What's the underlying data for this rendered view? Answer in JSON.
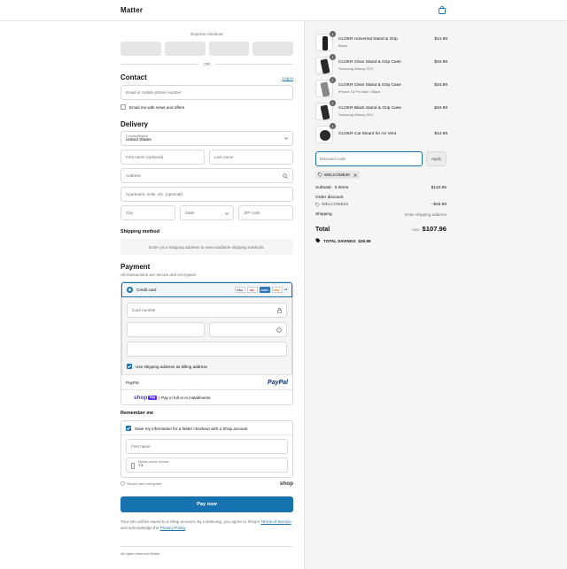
{
  "header": {
    "logo": "Matter",
    "cart_icon": "shopping-bag-icon"
  },
  "express": {
    "title": "Express checkout",
    "or": "OR"
  },
  "contact": {
    "heading": "Contact",
    "login": "Log in",
    "email_placeholder": "Email or mobile phone number",
    "news_label": "Email me with news and offers"
  },
  "delivery": {
    "heading": "Delivery",
    "country_label": "Country/Region",
    "country_value": "United States",
    "first_name": "First name (optional)",
    "last_name": "Last name",
    "address": "Address",
    "apartment": "Apartment, suite, etc. (optional)",
    "city": "City",
    "state": "State",
    "zip": "ZIP code"
  },
  "shipping": {
    "heading": "Shipping method",
    "message": "Enter your shipping address to view available shipping methods."
  },
  "payment": {
    "heading": "Payment",
    "subtitle": "All transactions are secure and encrypted.",
    "credit_card": "Credit card",
    "card_logos": [
      "VISA",
      "MC",
      "AMEX",
      "DISC",
      "+4"
    ],
    "card_number": "Card number",
    "billing_label": "Use shipping address as billing address",
    "paypal": "PayPal",
    "paypal_logo": "PayPal",
    "shoppay_logo": "shop",
    "shoppay_badge": "Pay",
    "shoppay_text": "Pay in full or in installments"
  },
  "remember": {
    "heading": "Remember me",
    "save_label": "Save my information for a faster checkout with a Shop account",
    "first_name": "First name",
    "phone_label": "Mobile phone number",
    "phone_prefix": "+1",
    "secure": "Secure and encrypted",
    "shop_logo": "shop"
  },
  "paynow": {
    "label": "Pay now"
  },
  "legal": {
    "text1": "Your info will be saved to a Shop account. By continuing, you agree to Shop's",
    "terms": "Terms of Service",
    "text2": "and acknowledge the",
    "privacy": "Privacy Policy",
    "dot": "."
  },
  "footer": {
    "rights": "All rights reserved Matter"
  },
  "cart": {
    "items": [
      {
        "qty": "1",
        "name": "CLOKR Universal Stand & Grip",
        "variant": "Black",
        "price": "$14.99"
      },
      {
        "qty": "1",
        "name": "CLOKR Clear Stand & Grip Case",
        "variant": "Samsung Galaxy S23",
        "price": "$34.99"
      },
      {
        "qty": "1",
        "name": "CLOKR Clear Stand & Grip Case",
        "variant": "iPhone 15 Pro Max / Black",
        "price": "$34.99"
      },
      {
        "qty": "1",
        "name": "CLOKR Black Stand & Grip Case",
        "variant": "Samsung Galaxy S23",
        "price": "$34.99"
      },
      {
        "qty": "1",
        "name": "CLOKR Car Mount for Air Vent",
        "variant": "",
        "price": "$14.99"
      }
    ],
    "discount_placeholder": "Discount code",
    "apply": "Apply",
    "tag": "WELCOME20",
    "subtotal_label": "Subtotal · 5 items",
    "subtotal": "$134.95",
    "order_discount": "Order discount",
    "discount_code": "WELCOME20",
    "discount_value": "−$26.99",
    "shipping_label": "Shipping",
    "shipping_value": "Enter shipping address",
    "total_label": "Total",
    "currency": "USD",
    "total": "$107.96",
    "savings_label": "TOTAL SAVINGS",
    "savings": "$26.99"
  },
  "colors": {
    "accent": "#1773b0",
    "panel": "#f5f5f5"
  }
}
